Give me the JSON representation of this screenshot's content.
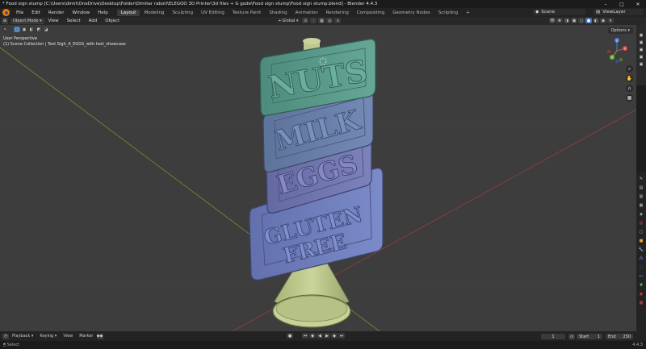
{
  "window": {
    "title": "* Food sign stump [C:\\Users\\dimit\\OneDrive\\Desktop\\Folder\\Dimitar raboti\\ELEGOO 3D Printer\\3d files + G gode\\Food sign stump\\Food sign stump.blend] - Blender 4.4.3",
    "min": "–",
    "max": "□",
    "close": "✕"
  },
  "menu": [
    "File",
    "Edit",
    "Render",
    "Window",
    "Help"
  ],
  "workspaces": [
    "Layout",
    "Modeling",
    "Sculpting",
    "UV Editing",
    "Texture Paint",
    "Shading",
    "Animation",
    "Rendering",
    "Compositing",
    "Geometry Nodes",
    "Scripting",
    "+"
  ],
  "scene": {
    "label": "Scene",
    "view_layer": "ViewLayer"
  },
  "viewport_header": {
    "mode": "Object Mode",
    "view": "View",
    "select": "Select",
    "add": "Add",
    "object": "Object",
    "orientation": "Global"
  },
  "viewport": {
    "perspective": "User Perspective",
    "collection": "(1) Scene Collection | Text Sigh_A_EGGS_with text_showcase",
    "options": "Options",
    "sign_words": [
      "NUTS",
      "MILK",
      "EGGS",
      "GLUTEN",
      "FREE"
    ],
    "gizmo": {
      "x": "X",
      "y": "Y",
      "z": "Z"
    }
  },
  "colors": {
    "viewport_bg": "#3d3d3d",
    "sign_nuts": "#5a9a8a",
    "sign_milk": "#6a7fa8",
    "sign_eggs": "#7378b0",
    "sign_gluten": "#6f7fc0",
    "cone": "#b9c58a",
    "accent": "#4772b3"
  },
  "timeline": {
    "editor": "Playback",
    "keying": "Keying",
    "view": "View",
    "marker": "Marker",
    "current_frame": "1",
    "start_label": "Start",
    "start": "1",
    "end_label": "End",
    "end": "250"
  },
  "status": {
    "left": "Select",
    "version": "4.4.3"
  }
}
